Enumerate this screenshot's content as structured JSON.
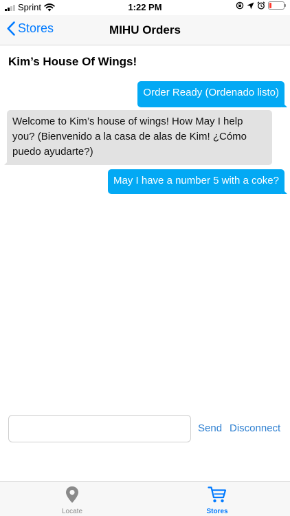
{
  "status_bar": {
    "carrier": "Sprint",
    "time": "1:22 PM"
  },
  "nav": {
    "back_label": "Stores",
    "title": "MIHU Orders"
  },
  "chat": {
    "store_name": "Kim’s House Of Wings!",
    "messages": [
      {
        "direction": "outgoing",
        "text": "Order Ready (Ordenado listo)"
      },
      {
        "direction": "incoming",
        "text": "Welcome to Kim’s house of wings! How May I help you? (Bienvenido a la casa de alas de Kim! ¿Cómo puedo ayudarte?)"
      },
      {
        "direction": "outgoing",
        "text": "May I have a number 5 with a coke?"
      }
    ]
  },
  "composer": {
    "value": "",
    "send_label": "Send",
    "disconnect_label": "Disconnect"
  },
  "tabs": [
    {
      "label": "Locate",
      "icon": "map-pin-icon",
      "selected": false
    },
    {
      "label": "Stores",
      "icon": "cart-icon",
      "selected": true
    }
  ],
  "colors": {
    "accent": "#007aff",
    "outgoing_bubble": "#03a9f4",
    "incoming_bubble": "#e2e2e2",
    "link": "#2f80d1",
    "battery_low": "#ff3b30"
  }
}
